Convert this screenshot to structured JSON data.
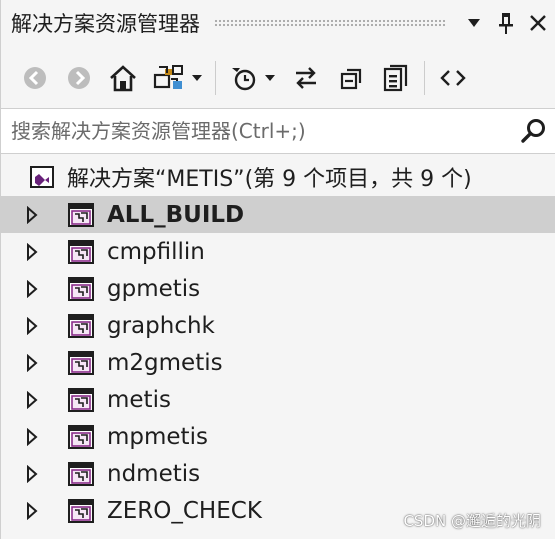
{
  "window": {
    "title": "解决方案资源管理器"
  },
  "search": {
    "placeholder": "搜索解决方案资源管理器(Ctrl+;)"
  },
  "solution": {
    "label": "解决方案“METIS”(第 9 个项目，共 9 个)"
  },
  "projects": [
    {
      "label": "ALL_BUILD",
      "selected": true
    },
    {
      "label": "cmpfillin"
    },
    {
      "label": "gpmetis"
    },
    {
      "label": "graphchk"
    },
    {
      "label": "m2gmetis"
    },
    {
      "label": "metis"
    },
    {
      "label": "mpmetis"
    },
    {
      "label": "ndmetis"
    },
    {
      "label": "ZERO_CHECK"
    }
  ],
  "watermark": "CSDN @邂逅的光阴",
  "colors": {
    "background": "#f5f5f5",
    "selected_row": "#cfcfcf",
    "icon_dark": "#1e1e1e",
    "project_icon_accent": "#8a2d8a",
    "solution_icon_accent": "#68217a"
  }
}
